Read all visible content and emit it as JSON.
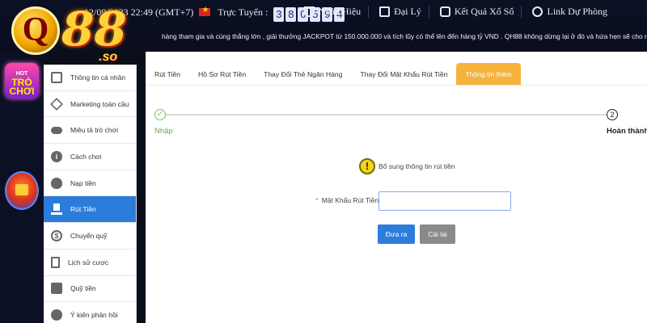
{
  "header": {
    "datetime": "12/09/2023 22:49 (GMT+7)",
    "online_label": "Trực Tuyến :",
    "online_digits": [
      "3",
      "8",
      "0",
      "5",
      "9",
      "4"
    ],
    "nav": [
      {
        "label": "Nhãn Hiệu",
        "icon": "trophy-icon"
      },
      {
        "label": "Đại Lý",
        "icon": "money-icon"
      },
      {
        "label": "Kết Quả Xổ Số",
        "icon": "dice-icon"
      },
      {
        "label": "Link Dự Phòng",
        "icon": "globe-icon"
      }
    ],
    "marquee": "hàng tham gia và cùng thắng lớn , giải thưởng JACKPOT từ 150.000.000 và tích lũy có thể lên đến hàng tỷ VND . QH88 không dừng lại ở đó và hứa hẹn sẽ cho ra mắt"
  },
  "logo": {
    "letter": "Q",
    "number": "88",
    "suffix": ".so"
  },
  "floating": {
    "game_badge_top": "HOT",
    "game_badge_line1": "TRÒ",
    "game_badge_line2": "CHƠI"
  },
  "sidebar": {
    "items": [
      {
        "label": "Thông tin cá nhân",
        "icon": "id-card-icon"
      },
      {
        "label": "Marketing toàn cầu",
        "icon": "diamond-icon"
      },
      {
        "label": "Miêu tả trò chơi",
        "icon": "gamepad-icon"
      },
      {
        "label": "Cách chơi",
        "icon": "info-icon"
      },
      {
        "label": "Nạp tiền",
        "icon": "apple-icon"
      },
      {
        "label": "Rút Tiền",
        "icon": "atm-icon",
        "active": true
      },
      {
        "label": "Chuyển quỹ",
        "icon": "dollar-icon"
      },
      {
        "label": "Lịch sử cược",
        "icon": "clipboard-icon"
      },
      {
        "label": "Quỹ tiền",
        "icon": "coins-icon"
      },
      {
        "label": "Ý kiến phản hồi",
        "icon": "chat-icon"
      }
    ]
  },
  "tabs": [
    {
      "label": "Rút Tiền"
    },
    {
      "label": "Hồ Sơ Rút Tiền"
    },
    {
      "label": "Thay Đổi Thẻ Ngân Hàng"
    },
    {
      "label": "Thay Đổi Mật Khẩu Rút Tiền"
    },
    {
      "label": "Thông tin thêm",
      "active": true
    }
  ],
  "steps": {
    "step1_label": "Nhập",
    "step1_mark": "✓",
    "step2_label": "Hoàn thành",
    "step2_number": "2"
  },
  "form": {
    "notice": "Bổ sung thông tin rút tiền",
    "password_required_mark": "*",
    "password_label": "Mật Khẩu Rút Tiền",
    "password_value": "",
    "submit_label": "Đưa ra",
    "reset_label": "Cài lại"
  },
  "colors": {
    "primary": "#2c7ddb",
    "active_tab": "#f7b23b",
    "step_done": "#7bbf5a"
  }
}
